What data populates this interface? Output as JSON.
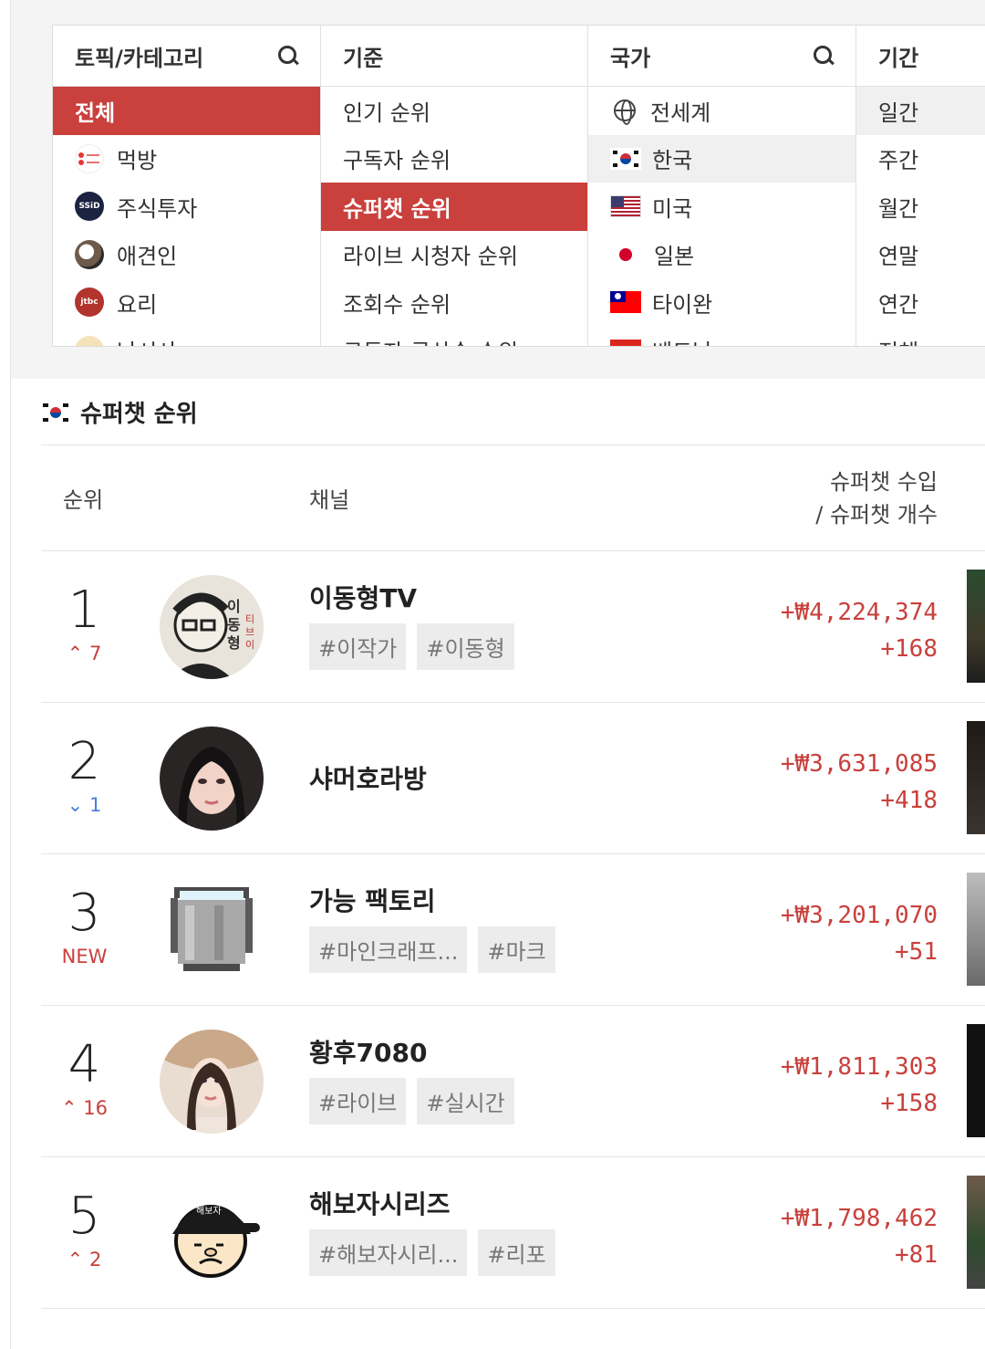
{
  "filters": {
    "topic": {
      "title": "토픽/카테고리",
      "items": [
        {
          "label": "전체",
          "active": true
        },
        {
          "label": "먹방"
        },
        {
          "label": "주식투자"
        },
        {
          "label": "애견인"
        },
        {
          "label": "요리"
        },
        {
          "label": "낚시사"
        }
      ]
    },
    "criteria": {
      "title": "기준",
      "items": [
        {
          "label": "인기 순위"
        },
        {
          "label": "구독자 순위"
        },
        {
          "label": "슈퍼챗 순위",
          "active": true
        },
        {
          "label": "라이브 시청자 순위"
        },
        {
          "label": "조회수 순위"
        },
        {
          "label": "구독자 급상승 순위"
        }
      ]
    },
    "country": {
      "title": "국가",
      "items": [
        {
          "label": "전세계"
        },
        {
          "label": "한국",
          "selected": true
        },
        {
          "label": "미국"
        },
        {
          "label": "일본"
        },
        {
          "label": "타이완"
        },
        {
          "label": "베트남"
        }
      ]
    },
    "period": {
      "title": "기간",
      "items": [
        {
          "label": "일간",
          "selected": true
        },
        {
          "label": "주간"
        },
        {
          "label": "월간"
        },
        {
          "label": "연말"
        },
        {
          "label": "연간"
        },
        {
          "label": "전체"
        }
      ]
    }
  },
  "ranking": {
    "title": "슈퍼챗 순위",
    "columns": {
      "rank": "순위",
      "channel": "채널",
      "income_line1": "슈퍼챗 수입",
      "income_line2": "/ 슈퍼챗 개수"
    },
    "rows": [
      {
        "rank": "1",
        "change": "7",
        "dir": "up",
        "name": "이동형TV",
        "tags": [
          "#이작가",
          "#이동형"
        ],
        "amount": "+₩4,224,374",
        "count": "+168"
      },
      {
        "rank": "2",
        "change": "1",
        "dir": "down",
        "name": "샤머호라방",
        "tags": [],
        "amount": "+₩3,631,085",
        "count": "+418"
      },
      {
        "rank": "3",
        "change": "NEW",
        "dir": "new",
        "name": "가능 팩토리",
        "tags": [
          "#마인크래프...",
          "#마크"
        ],
        "amount": "+₩3,201,070",
        "count": "+51"
      },
      {
        "rank": "4",
        "change": "16",
        "dir": "up",
        "name": "황후7080",
        "tags": [
          "#라이브",
          "#실시간"
        ],
        "amount": "+₩1,811,303",
        "count": "+158"
      },
      {
        "rank": "5",
        "change": "2",
        "dir": "up",
        "name": "해보자시리즈",
        "tags": [
          "#해보자시리...",
          "#리포"
        ],
        "amount": "+₩1,798,462",
        "count": "+81"
      }
    ]
  },
  "colors": {
    "accent": "#c9403c",
    "down": "#4a7fdc"
  }
}
